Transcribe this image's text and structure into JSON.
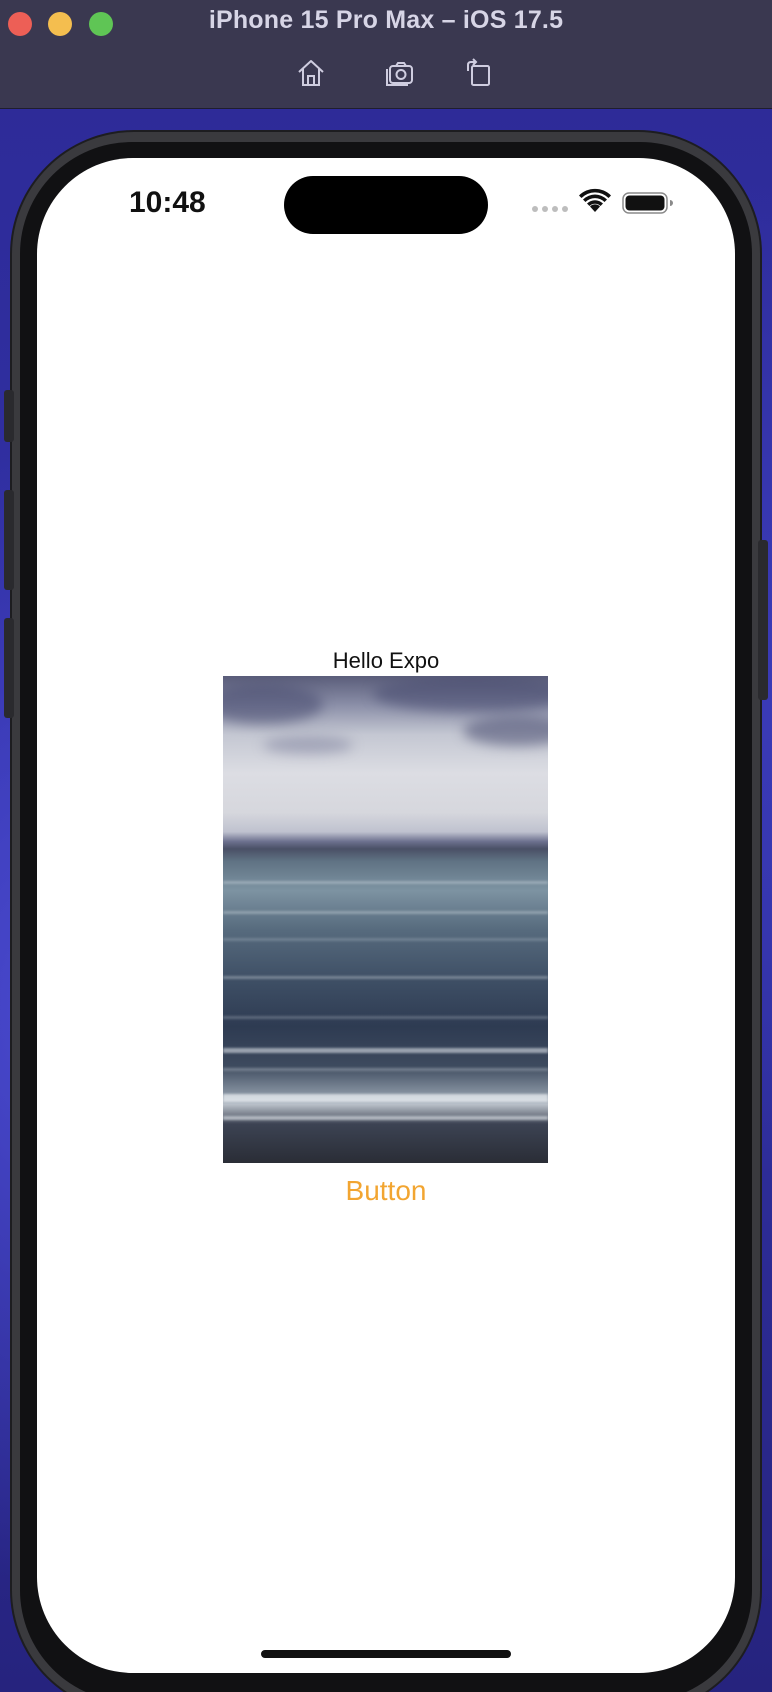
{
  "window": {
    "title": "iPhone 15 Pro Max – iOS 17.5"
  },
  "toolbar": {
    "items": [
      {
        "name": "home",
        "icon": "home-icon"
      },
      {
        "name": "screenshot",
        "icon": "camera-icon"
      },
      {
        "name": "rotate",
        "icon": "rotate-icon"
      }
    ]
  },
  "status_bar": {
    "time": "10:48",
    "signal_icon": "signal-dots-icon",
    "wifi_icon": "wifi-icon",
    "battery_icon": "battery-icon"
  },
  "app": {
    "title": "Hello Expo",
    "image_icon": "sea-photo",
    "button_label": "Button",
    "button_color": "#f2a531"
  }
}
